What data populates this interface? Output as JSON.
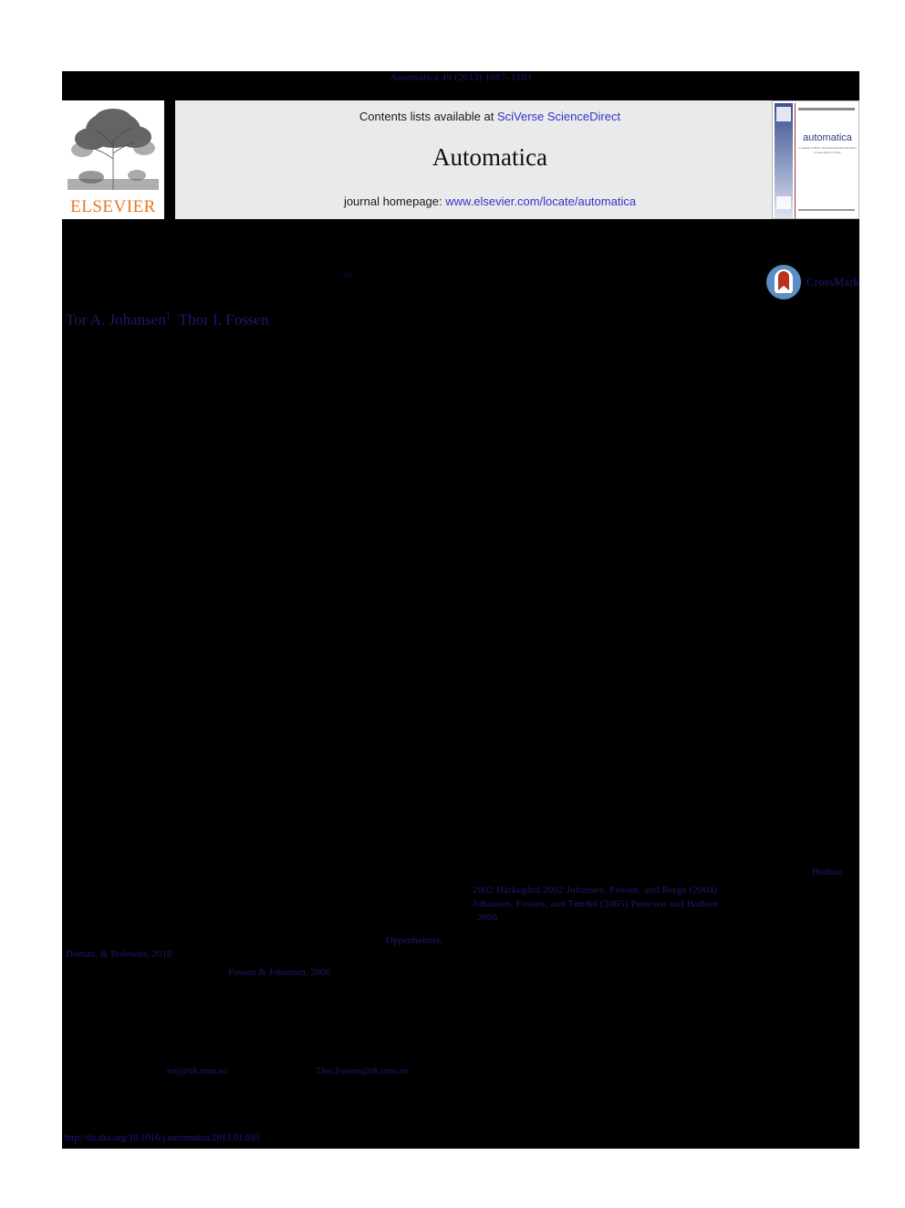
{
  "running_head": "Automatica 49 (2013) 1087–1103",
  "masthead": {
    "elsevier_wordmark": "ELSEVIER",
    "contents_prefix": "Contents lists available at ",
    "contents_link": "SciVerse ScienceDirect",
    "journal_title": "Automatica",
    "homepage_prefix": "journal homepage: ",
    "homepage_link": "www.elsevier.com/locate/automatica",
    "cover": {
      "journal_name": "automatica",
      "subtitle": "a journal of IFAC, the International Federation of Automatic Control"
    }
  },
  "crossmark": {
    "label": "CrossMark"
  },
  "article": {
    "star_marker": "☆",
    "title": "",
    "authors_line": {
      "author_1": "Tor A. Johansen",
      "author_1_marker": "1",
      "author_2": "Thor I. Fossen"
    }
  },
  "citations": {
    "bodson_lead": "Bodson",
    "row_2": "2002   Härkegård 2002   Johansen, Fossen, and Berge (2004)",
    "row_3": "Johansen, Fossen, and Tøndel (2005)       Petersen and Bodson",
    "row_4": "2006",
    "oppenheimer": "Oppenheimer,",
    "doman_bolender": "Doman, & Bolender, 2010",
    "fossen_johansen": "Fossen & Johansen, 2006"
  },
  "footnotes": {
    "email_1": "torj@itk.ntnu.no",
    "email_2": "Thor.Fossen@itk.ntnu.no"
  },
  "footer": {
    "doi_url": "http://dx.doi.org/10.1016/j.automatica.2013.01.035"
  },
  "colors": {
    "link_blue": "#3333cc",
    "citation_navy": "#1a1a6e",
    "elsevier_orange": "#e87722",
    "banner_gray": "#eaeaea",
    "page_black": "#000000"
  }
}
